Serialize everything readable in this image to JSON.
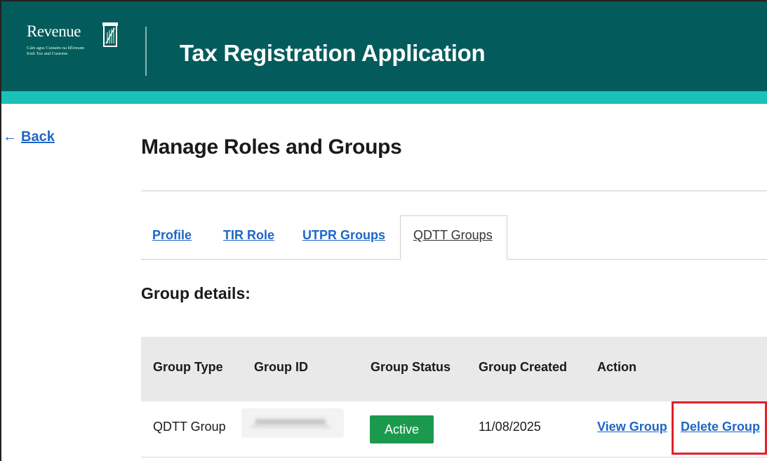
{
  "header": {
    "logo": {
      "word": "Revenue",
      "line1": "Cáin agus Custaim na hÉireann",
      "line2": "Irish Tax and Customs",
      "icon": "harp-icon"
    },
    "title": "Tax Registration Application"
  },
  "nav": {
    "back_label": "Back",
    "back_icon": "←"
  },
  "page": {
    "title": "Manage Roles and Groups"
  },
  "tabs": [
    {
      "label": "Profile",
      "active": false
    },
    {
      "label": "TIR Role",
      "active": false
    },
    {
      "label": "UTPR Groups",
      "active": false
    },
    {
      "label": "QDTT Groups",
      "active": true
    }
  ],
  "section": {
    "title": "Group details:"
  },
  "table": {
    "headers": [
      "Group Type",
      "Group ID",
      "Group Status",
      "Group Created",
      "Action"
    ],
    "rows": [
      {
        "group_type": "QDTT Group",
        "group_id": "",
        "group_status": "Active",
        "group_created": "11/08/2025",
        "actions": [
          "View Group",
          "Delete Group"
        ]
      }
    ]
  },
  "colors": {
    "header_bg": "#035c5b",
    "header_stripe": "#19c1b8",
    "link": "#1f66c4",
    "status_active": "#1b9a4e",
    "highlight_box": "#e0202a"
  }
}
